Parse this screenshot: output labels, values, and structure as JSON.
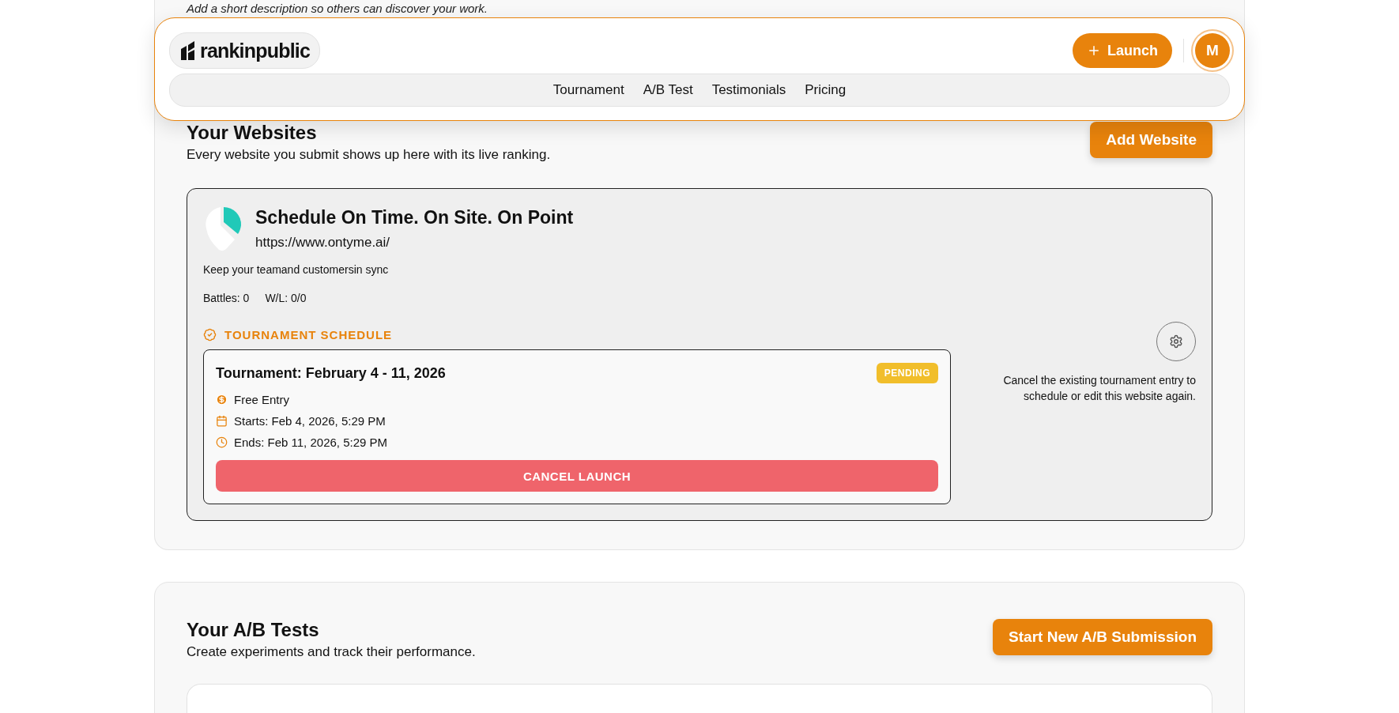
{
  "header_note": "Add a short description so others can discover your work.",
  "logo": {
    "text": "rankinpublic"
  },
  "nav": [
    {
      "label": "Tournament"
    },
    {
      "label": "A/B Test"
    },
    {
      "label": "Testimonials"
    },
    {
      "label": "Pricing"
    }
  ],
  "launch_button": "Launch",
  "avatar": "M",
  "websites": {
    "title": "Your Websites",
    "subtitle": "Every website you submit shows up here with its live ranking.",
    "add_button": "Add Website",
    "cards": [
      {
        "title": "Schedule On Time. On Site. On Point",
        "url": "https://www.ontyme.ai/",
        "description": "Keep your teamand customersin sync",
        "stats": [
          "Battles: 0",
          "W/L: 0/0"
        ],
        "schedule_heading": "TOURNAMENT SCHEDULE",
        "tournament": {
          "title": "Tournament: February 4 - 11, 2026",
          "status": "PENDING",
          "details": [
            {
              "kind": "fee",
              "text": "Free Entry"
            },
            {
              "kind": "start",
              "text": "Starts: Feb 4, 2026, 5:29 PM"
            },
            {
              "kind": "end",
              "text": "Ends: Feb 11, 2026, 5:29 PM"
            }
          ],
          "cancel_button": "CANCEL LAUNCH"
        },
        "note": "Cancel the existing tournament entry to schedule or edit this website again."
      }
    ]
  },
  "ab_tests": {
    "title": "Your A/B Tests",
    "subtitle": "Create experiments and track their performance.",
    "start_button": "Start New A/B Submission"
  }
}
